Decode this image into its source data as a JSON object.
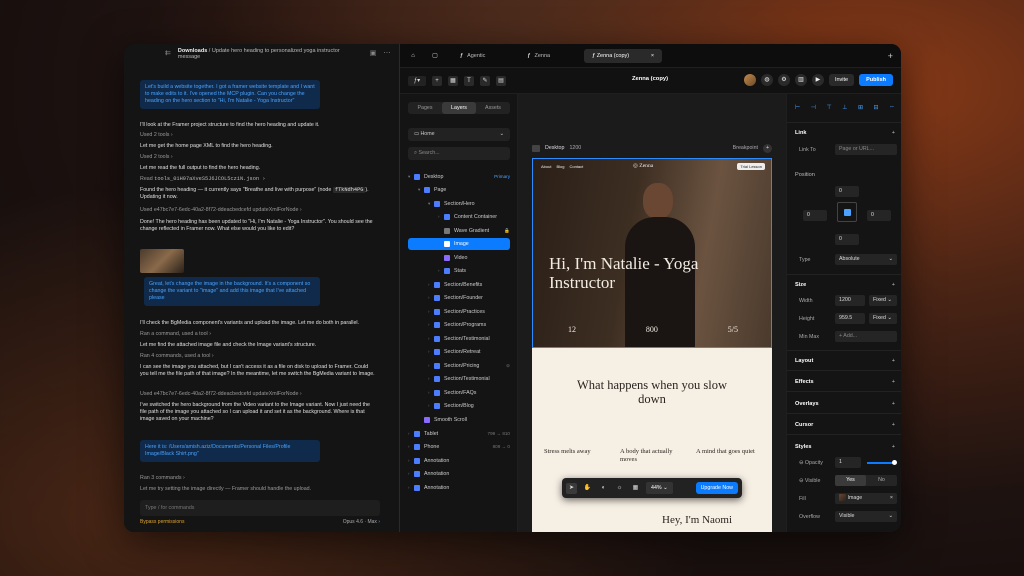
{
  "chat": {
    "breadcrumb_root": "Downloads",
    "breadcrumb_rest": " / Update hero heading to personalized yoga instructor message",
    "msg1": "Let's build a website together. I got a framer website template and I want to make edits to it. I've opened the MCP plugin. Can you change the heading on the hero section to \"Hi, I'm Natalie - Yoga Instructor\"",
    "l1": "I'll look at the Framer project structure to find the hero heading and update it.",
    "l2": "Used 2 tools ›",
    "l3": "Let me get the home page XML to find the hero heading.",
    "l4": "Used 2 tools ›",
    "l5": "Let me read the full output to find the hero heading.",
    "l6a": "Read",
    "l6b": "tools_01H97aXveS5J6JCOL5cziN.json ›",
    "l7a": "Found the hero heading — it currently says \"Breathe and live with purpose\" (node",
    "l7code": "fTkNdh4PG",
    "l7b": "). Updating it now.",
    "l8": "Used e47bc7e7-6edc-40a2-8f72-ddeacbedcefd updateXmlForNode ›",
    "l9": "Done! The hero heading has been updated to \"Hi, I'm Natalie - Yoga Instructor\". You should see the change reflected in Framer now. What else would you like to edit?",
    "msg2": "Great, let's change the image in the background. It's a component so change the variant to \"image\" and add this image that I've attached please",
    "l10": "I'll check the BgMedia component's variants and upload the image. Let me do both in parallel.",
    "l11": "Ran a command, used a tool ›",
    "l12": "Let me find the attached image file and check the Image variant's structure.",
    "l13": "Ran 4 commands, used a tool ›",
    "l14": "I can see the image you attached, but I can't access it as a file on disk to upload to Framer. Could you tell me the file path of that image? In the meantime, let me switch the BgMedia variant to Image.",
    "l15": "Used e47bc7e7-6edc-40a2-8f72-ddeacbedcefd updateXmlForNode ›",
    "l16": "I've switched the hero background from the Video variant to the Image variant. Now I just need the file path of the image you attached so I can upload it and set it as the background. Where is that image saved on your machine?",
    "msg3": "Here it is: /Users/amish.aziz/Documents/Personal Files/Profile Image/Black Shirt.png\"",
    "l17": "Ran 3 commands ›",
    "l18": "Let me try setting the image directly — Framer should handle the upload.",
    "input_placeholder": "Type / for commands",
    "perm": "Bypass permissions",
    "model": "Opus 4.6",
    "model_max": "Max"
  },
  "tabs": [
    "Agentic",
    "Zenna",
    "Zenna (copy)"
  ],
  "toolbar": {
    "project": "Zenna (copy)",
    "invite": "Invite",
    "publish": "Publish"
  },
  "layers": {
    "seg": [
      "Pages",
      "Layers",
      "Assets"
    ],
    "page": "Home",
    "search_placeholder": "Search...",
    "rows": [
      {
        "label": "Desktop",
        "tag": "Primary"
      },
      {
        "label": "Page",
        "tag": ""
      },
      {
        "label": "Section/Hero",
        "tag": ""
      },
      {
        "label": "Content Container",
        "tag": ""
      },
      {
        "label": "Wave Gradient",
        "tag": ""
      },
      {
        "label": "Image",
        "tag": ""
      },
      {
        "label": "Video",
        "tag": ""
      },
      {
        "label": "Stats",
        "tag": ""
      },
      {
        "label": "Section/Benefits",
        "tag": ""
      },
      {
        "label": "Section/Founder",
        "tag": ""
      },
      {
        "label": "Section/Practices",
        "tag": ""
      },
      {
        "label": "Section/Programs",
        "tag": ""
      },
      {
        "label": "Section/Testimonial",
        "tag": ""
      },
      {
        "label": "Section/Retreat",
        "tag": ""
      },
      {
        "label": "Section/Pricing",
        "tag": ""
      },
      {
        "label": "Section/Testimonial",
        "tag": ""
      },
      {
        "label": "Section/FAQs",
        "tag": ""
      },
      {
        "label": "Section/Blog",
        "tag": ""
      },
      {
        "label": "Smooth Scroll",
        "tag": ""
      },
      {
        "label": "Tablet",
        "tag": "799 → 810"
      },
      {
        "label": "Phone",
        "tag": "809 → 0"
      },
      {
        "label": "Annotation",
        "tag": ""
      },
      {
        "label": "Annotation",
        "tag": ""
      },
      {
        "label": "Annotation",
        "tag": ""
      }
    ]
  },
  "canvas": {
    "breakpoint_name": "Desktop",
    "breakpoint_width": "1200",
    "breakpoint_label": "Breakpoint",
    "hero_nav": [
      "About",
      "Blog",
      "Contact"
    ],
    "brand": "Zenna",
    "cta": "Trial Lesson",
    "hero_title": "Hi, I'm Natalie - Yoga Instructor",
    "stats": [
      "12",
      "800",
      "5/5"
    ],
    "s2_title": "What happens when you slow down",
    "cols": [
      "Stress melts away",
      "A body that actually moves",
      "A mind that goes quiet"
    ],
    "hey": "Hey, I'm Naomi",
    "zoom": "44%",
    "upgrade": "Upgrade Now"
  },
  "props": {
    "link": "Link",
    "link_to": "Link To",
    "link_placeholder": "Page or URL...",
    "position": "Position",
    "pos_top": "0",
    "pos_left": "0",
    "pos_right": "0",
    "pos_bottom": "0",
    "type_label": "Type",
    "type_value": "Absolute",
    "size": "Size",
    "width_label": "Width",
    "width": "1200",
    "width_mode": "Fixed",
    "height_label": "Height",
    "height": "959.5",
    "height_mode": "Fixed",
    "minmax_label": "Min Max",
    "minmax_add": "Add...",
    "layout": "Layout",
    "effects": "Effects",
    "overlays": "Overlays",
    "cursor": "Cursor",
    "styles": "Styles",
    "opacity_label": "Opacity",
    "opacity": "1",
    "visible_label": "Visible",
    "yes": "Yes",
    "no": "No",
    "fill_label": "Fill",
    "fill_value": "Image",
    "overflow_label": "Overflow",
    "overflow_value": "Visible",
    "plus": "+"
  }
}
